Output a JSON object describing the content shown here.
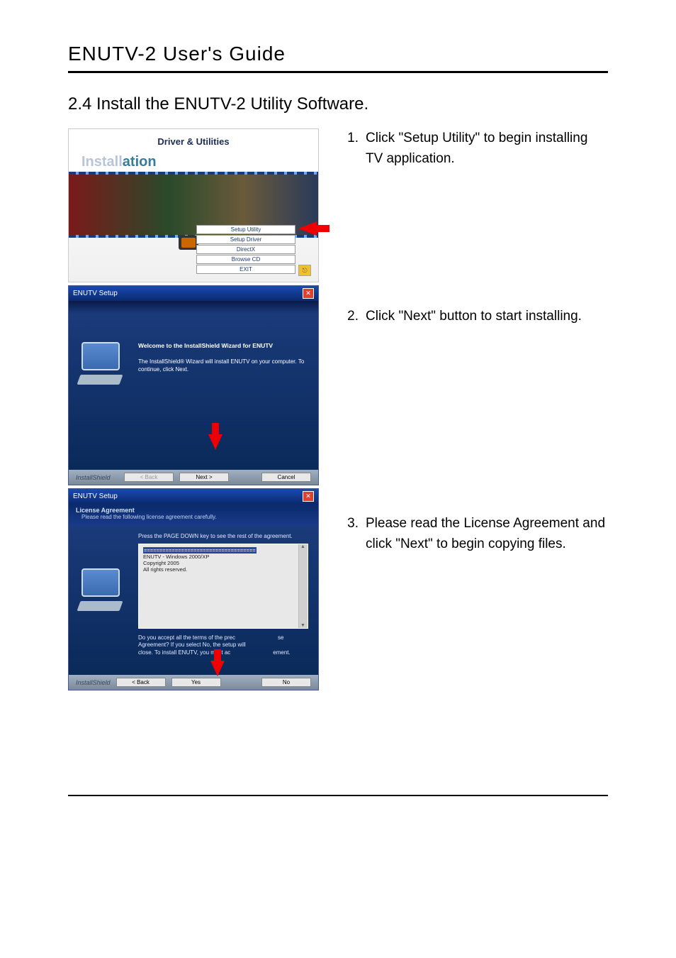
{
  "doc": {
    "header": "ENUTV-2  User's  Guide",
    "section": "2.4 Install the ENUTV-2 Utility Software."
  },
  "instructions": [
    {
      "n": "1.",
      "text": "Click \"Setup Utility\" to begin installing TV application."
    },
    {
      "n": "2.",
      "text": "Click \"Next\" button to start installing."
    },
    {
      "n": "3.",
      "text": "Please read the License Agreement and click \"Next\" to begin copying files."
    }
  ],
  "launcher": {
    "title": "Driver & Utilities",
    "installation_word_a": "Install",
    "installation_word_b": "ation",
    "menu": [
      "Setup Utility",
      "Setup Driver",
      "DirectX",
      "Browse CD",
      "EXIT"
    ],
    "exit_glyph": "⎋"
  },
  "wizard1": {
    "title": "ENUTV Setup",
    "welcome": "Welcome to the InstallShield Wizard for ENUTV",
    "desc": "The InstallShield® Wizard will install ENUTV on your computer.  To continue, click Next.",
    "brand": "InstallShield",
    "back": "< Back",
    "next": "Next >",
    "cancel": "Cancel"
  },
  "wizard2": {
    "title": "ENUTV Setup",
    "sub_title": "License Agreement",
    "sub_desc": "Please read the following license agreement carefully.",
    "instr": "Press the PAGE DOWN key to see the rest of the agreement.",
    "license_lines": [
      "====================================",
      "ENUTV - Windows 2000/XP",
      "Copyright 2005",
      "All rights reserved."
    ],
    "question_a": "Do you accept all the terms of the prec",
    "question_b": "se Agreement? If you select No, the setup will",
    "question_c": "close. To install ENUTV, you must ac",
    "question_d": "ement.",
    "brand": "InstallShield",
    "back": "< Back",
    "yes": "Yes",
    "no": "No"
  }
}
